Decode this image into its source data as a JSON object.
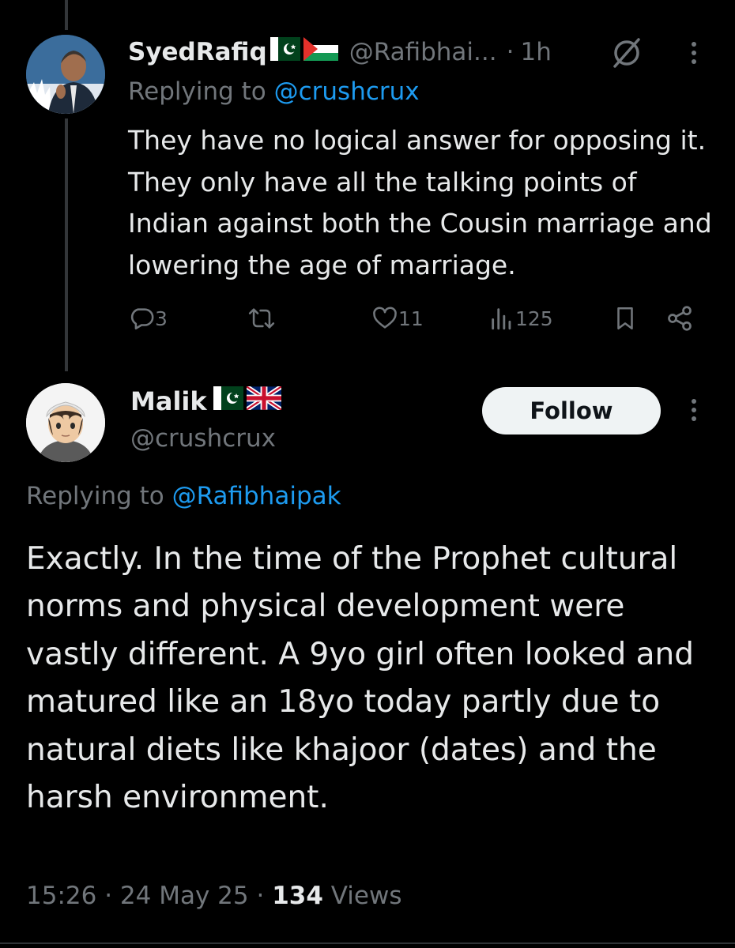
{
  "reply_tweet": {
    "display_name": "SyedRafiq",
    "handle": "@Rafibhai...",
    "separator": "·",
    "time": "1h",
    "replying_prefix": "Replying to ",
    "replying_to": "@crushcrux",
    "text": "They have no logical answer for opposing it. They only have all the talking points of Indian against both the Cousin marriage and lowering the age of marriage.",
    "replies": "3",
    "likes": "11",
    "views": "125",
    "icons": [
      "grok-icon",
      "more-options-icon",
      "reply-icon",
      "retweet-icon",
      "like-icon",
      "views-icon",
      "bookmark-icon",
      "share-icon"
    ],
    "flags": [
      "pakistan-flag",
      "palestine-flag"
    ]
  },
  "main_tweet": {
    "display_name": "Malik",
    "handle": "@crushcrux",
    "follow_label": "Follow",
    "replying_prefix": "Replying to ",
    "replying_to": "@Rafibhaipak",
    "text": "Exactly. In the time of the Prophet cultural norms and physical development were vastly different. A 9yo girl often looked and matured like an 18yo today partly due to natural diets like khajoor (dates) and the harsh environment.",
    "time": "15:26",
    "date": "24 May 25",
    "separator": "·",
    "views_count": "134",
    "views_label": "Views",
    "flags": [
      "pakistan-flag",
      "uk-flag"
    ]
  },
  "colors": {
    "background": "#000000",
    "text": "#e7e9ea",
    "secondary": "#71767b",
    "accent": "#1d9bf0",
    "follow_bg": "#eff3f4"
  }
}
